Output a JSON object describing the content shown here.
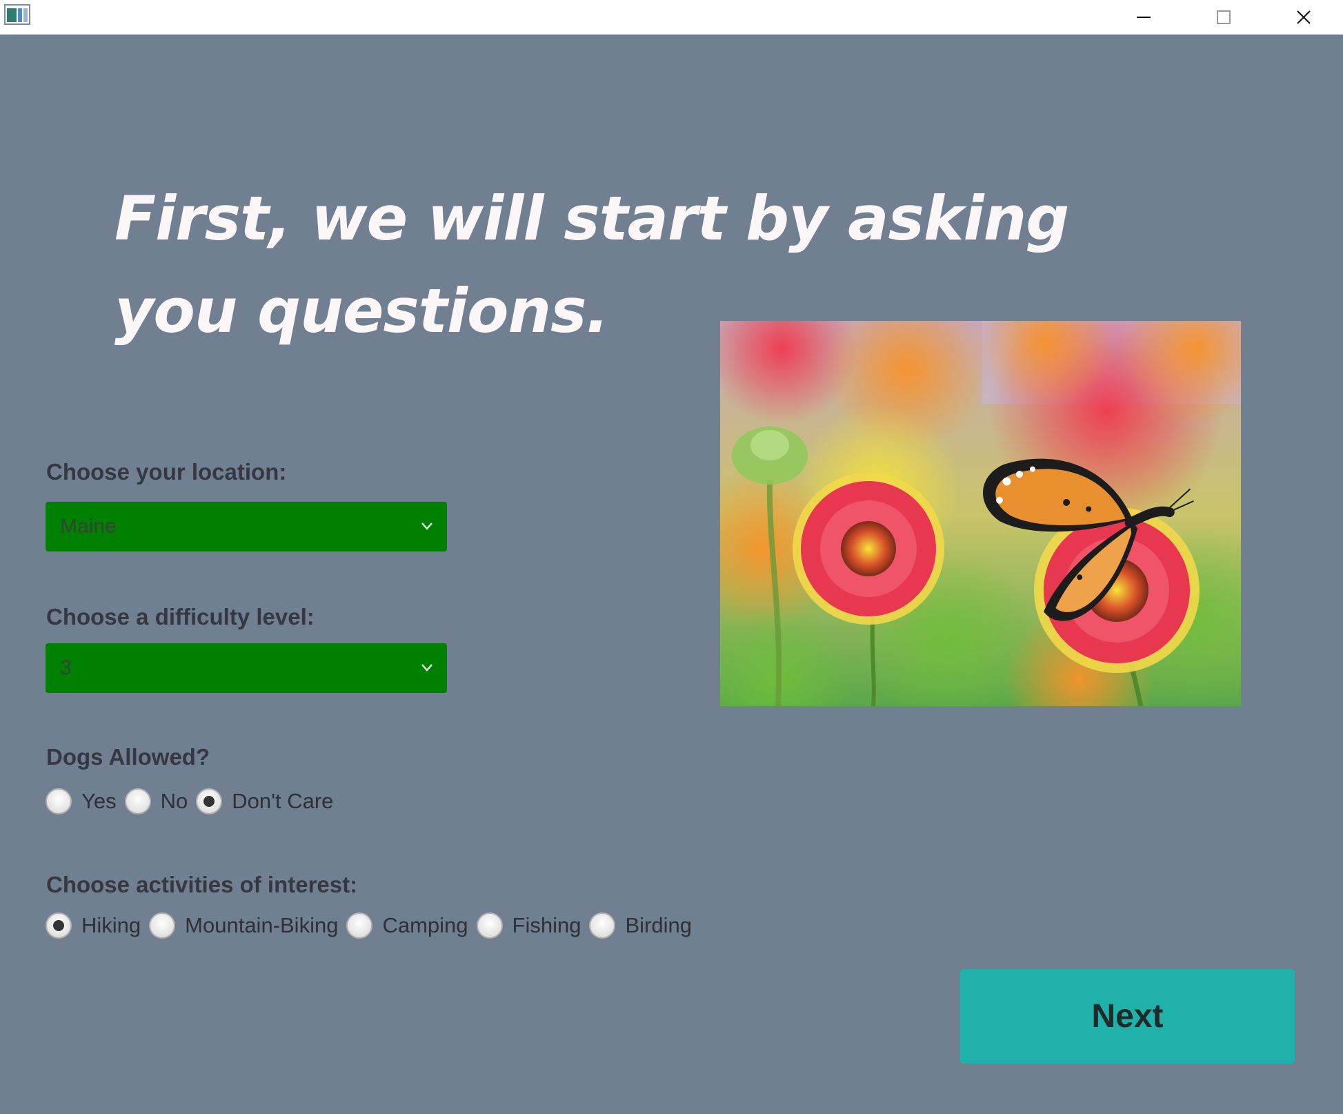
{
  "window": {
    "minimize_icon": "minimize-icon",
    "maximize_icon": "maximize-icon",
    "close_icon": "close-icon"
  },
  "headline": "First, we will start by asking you questions.",
  "location": {
    "label": "Choose your location:",
    "selected": "Maine"
  },
  "difficulty": {
    "label": "Choose a difficulty level:",
    "selected": "3"
  },
  "dogs": {
    "label": "Dogs Allowed?",
    "options": [
      {
        "label": "Yes",
        "selected": false
      },
      {
        "label": "No",
        "selected": false
      },
      {
        "label": "Don't Care",
        "selected": true
      }
    ]
  },
  "activities": {
    "label": "Choose activities of interest:",
    "options": [
      {
        "label": "Hiking",
        "selected": true
      },
      {
        "label": "Mountain-Biking",
        "selected": false
      },
      {
        "label": "Camping",
        "selected": false
      },
      {
        "label": "Fishing",
        "selected": false
      },
      {
        "label": "Birding",
        "selected": false
      }
    ]
  },
  "next_button": "Next",
  "colors": {
    "background": "#708090",
    "combo": "#008000",
    "next_button": "#20b2aa",
    "headline": "#fbf7f9"
  }
}
